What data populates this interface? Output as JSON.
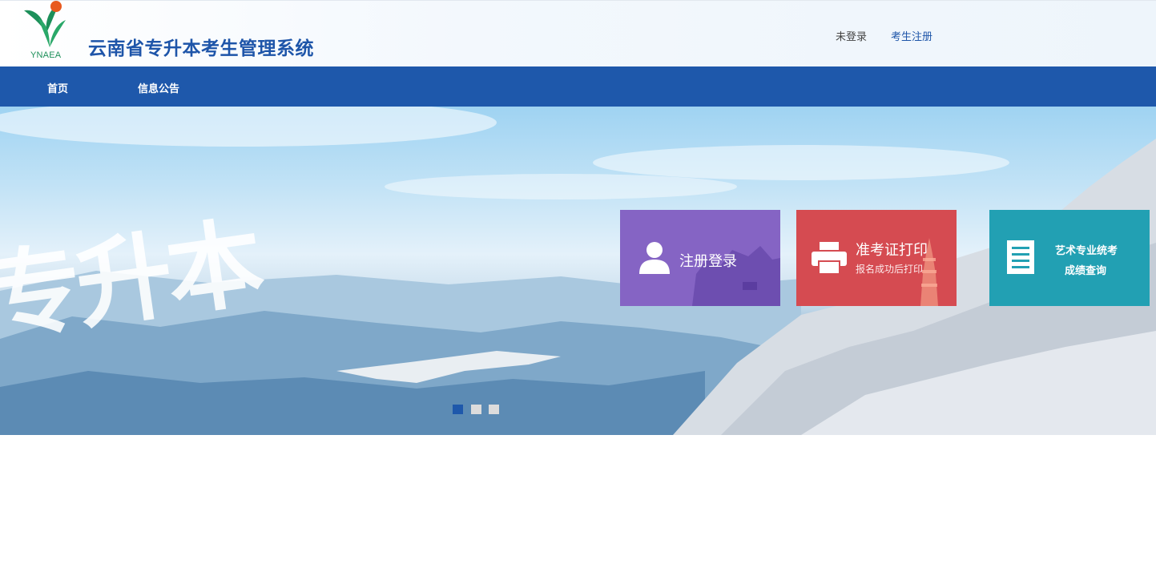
{
  "header": {
    "logo_text": "YNAEA",
    "title": "云南省专升本考生管理系统",
    "login_status": "未登录",
    "register_label": "考生注册"
  },
  "nav": {
    "items": [
      {
        "label": "首页"
      },
      {
        "label": "信息公告"
      }
    ]
  },
  "banner": {
    "calligraphy": "专升本",
    "tiles": [
      {
        "title": "注册登录",
        "icon": "user-icon",
        "color": "#8564c4"
      },
      {
        "title": "准考证打印",
        "subtitle": "报名成功后打印",
        "icon": "printer-icon",
        "color": "#d54b51"
      },
      {
        "line1": "艺术专业统考",
        "line2": "成绩查询",
        "icon": "document-icon",
        "color": "#22a0b3"
      }
    ],
    "carousel": {
      "count": 3,
      "active_index": 0
    }
  },
  "colors": {
    "brand_blue": "#1e58ab",
    "title_blue": "#1e55a9"
  }
}
